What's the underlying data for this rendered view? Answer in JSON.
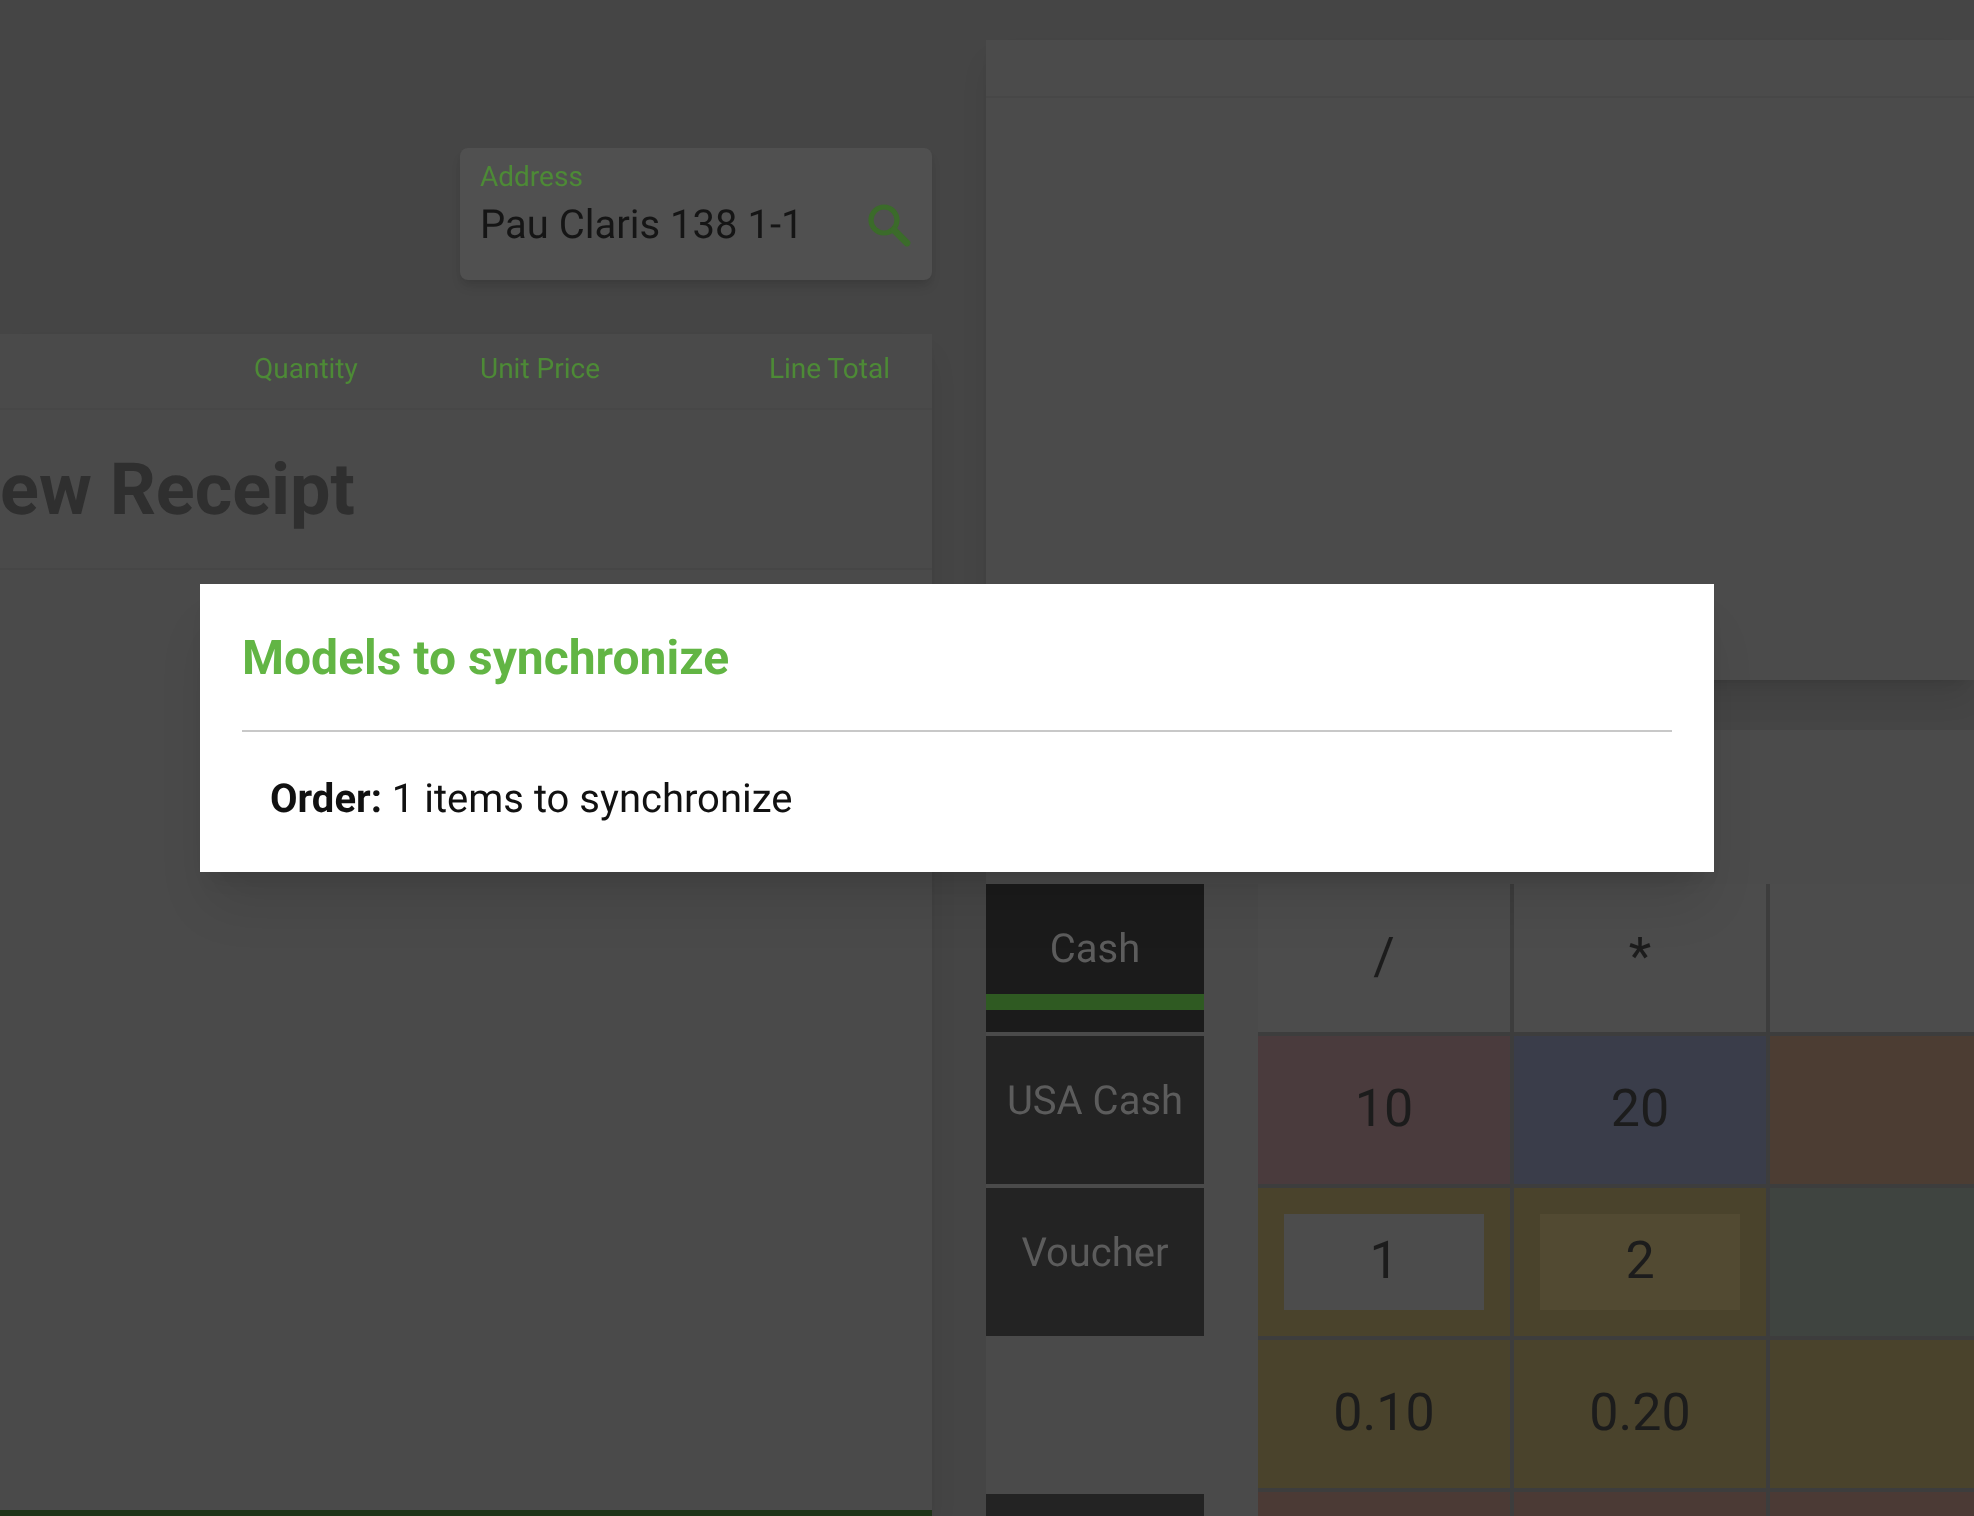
{
  "address": {
    "label": "Address",
    "value": "Pau Claris 138 1-1"
  },
  "receipt": {
    "columns": [
      "Quantity",
      "Unit Price",
      "Line Total"
    ],
    "title": "ew Receipt"
  },
  "payment_methods": [
    {
      "label": "Cash",
      "selected": true
    },
    {
      "label": "USA Cash",
      "selected": false
    },
    {
      "label": "Voucher",
      "selected": false
    }
  ],
  "keypad": [
    [
      {
        "label": "/",
        "color": "#4c4c4c"
      },
      {
        "label": "*",
        "color": "#4c4c4c"
      },
      {
        "color": "#4c4c4c"
      }
    ],
    [
      {
        "label": "10",
        "color": "#4a3b3d"
      },
      {
        "label": "20",
        "color": "#3a3d4a"
      },
      {
        "color": "#4c3d33"
      }
    ],
    [
      {
        "label": "1",
        "color": "#4a432c",
        "kind": "framed_grey"
      },
      {
        "label": "2",
        "color": "#4a432c",
        "kind": "framed"
      },
      {
        "color": "#3f4440"
      }
    ],
    [
      {
        "label": "0.10",
        "color": "#4a432c"
      },
      {
        "label": "0.20",
        "color": "#4a432c"
      },
      {
        "color": "#4a432c"
      }
    ],
    [
      {
        "color": "#4b3a35"
      },
      {
        "color": "#4b3a35"
      },
      {
        "color": "#4b3a35"
      }
    ]
  ],
  "dialog": {
    "title": "Models to synchronize",
    "lines": [
      {
        "text": "**Order:** 1 items to synchronize"
      }
    ]
  }
}
